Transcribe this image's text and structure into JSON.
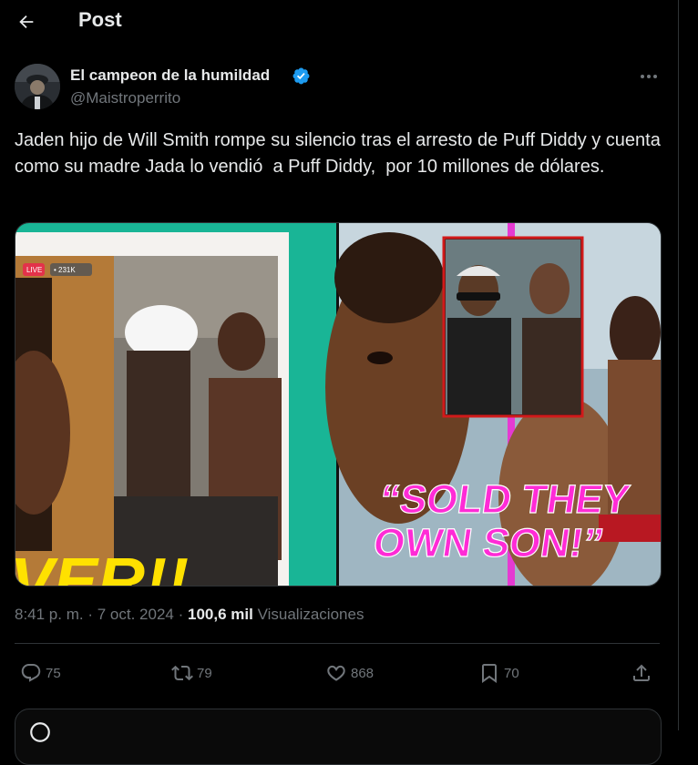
{
  "header": {
    "title": "Post"
  },
  "author": {
    "name": "El campeon de la humildad",
    "handle": "@Maistroperrito"
  },
  "tweet": {
    "text": "Jaden hijo de Will Smith rompe su silencio tras el arresto de Puff Diddy y cuenta como su madre Jada lo vendió  a Puff Diddy,  por 10 millones de dólares."
  },
  "media": {
    "badge_live": "LIVE",
    "badge_viewers": "• 231K",
    "overlay_caption": "“SOLD THEY OWN SON!”",
    "bottom_left_fragment": "VER!!"
  },
  "meta": {
    "time": "8:41 p. m.",
    "separator": "·",
    "date": "7 oct. 2024",
    "views_count": "100,6 mil",
    "views_label": "Visualizaciones"
  },
  "actions": {
    "replies": "75",
    "reposts": "79",
    "likes": "868",
    "bookmarks": "70"
  },
  "colors": {
    "background": "#000000",
    "text": "#e7e9ea",
    "muted": "#71767b",
    "border": "#2f3336",
    "verified": "#1d9bf0",
    "caption_magenta": "#ff2bd6"
  }
}
